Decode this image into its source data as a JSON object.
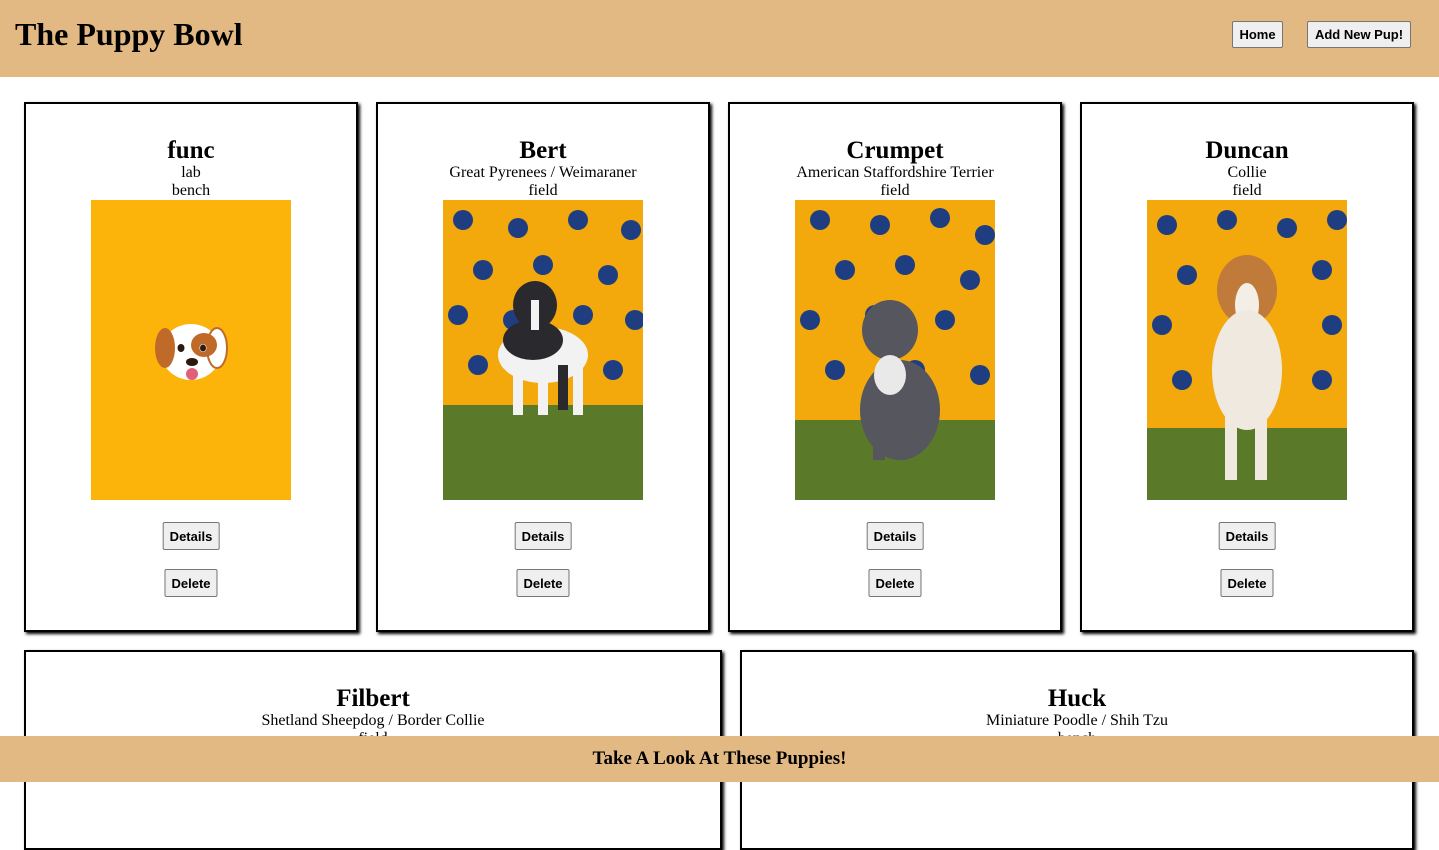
{
  "header": {
    "title": "The Puppy Bowl",
    "home_label": "Home",
    "add_label": "Add New Pup!"
  },
  "puppies": [
    {
      "name": "func",
      "breed": "lab",
      "status": "bench",
      "photo": "placeholder-dog-emoji",
      "details_label": "Details",
      "delete_label": "Delete"
    },
    {
      "name": "Bert",
      "breed": "Great Pyrenees / Weimaraner",
      "status": "field",
      "photo": "black-white-puppy-standing",
      "details_label": "Details",
      "delete_label": "Delete"
    },
    {
      "name": "Crumpet",
      "breed": "American Staffordshire Terrier",
      "status": "field",
      "photo": "grey-puppy-sitting",
      "details_label": "Details",
      "delete_label": "Delete"
    },
    {
      "name": "Duncan",
      "breed": "Collie",
      "status": "field",
      "photo": "sable-collie-puppy-standing",
      "details_label": "Details",
      "delete_label": "Delete"
    },
    {
      "name": "Filbert",
      "breed": "Shetland Sheepdog / Border Collie",
      "status": "field"
    },
    {
      "name": "Huck",
      "breed": "Miniature Poodle / Shih Tzu",
      "status": "bench"
    }
  ],
  "footer": {
    "text": "Take A Look At These Puppies!"
  },
  "colors": {
    "header_bg": "#e2b983",
    "photo_bg": "#fdb40a",
    "grass": "#5a7a2a"
  }
}
